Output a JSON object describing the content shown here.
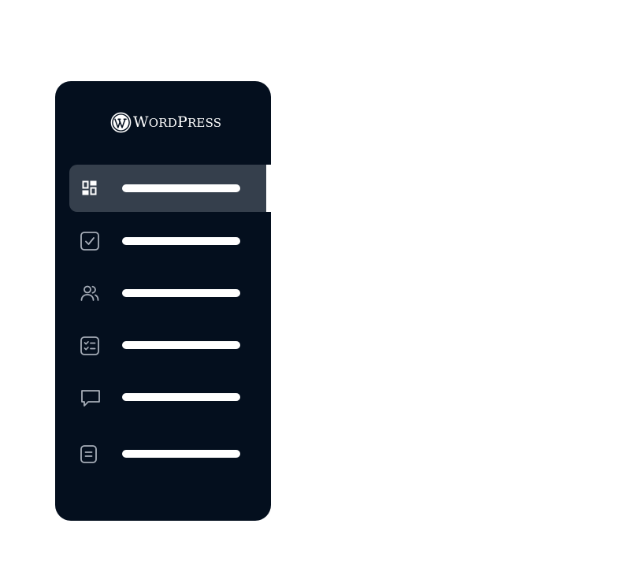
{
  "logo": {
    "text_first": "W",
    "text_rest": "ORD",
    "text_second": "P",
    "text_second_rest": "RESS",
    "icon": "wordpress-logo-icon"
  },
  "menu": {
    "items": [
      {
        "name": "dashboard",
        "icon": "dashboard-icon",
        "active": true
      },
      {
        "name": "tasks",
        "icon": "checkbox-icon",
        "active": false
      },
      {
        "name": "users",
        "icon": "users-icon",
        "active": false
      },
      {
        "name": "checklist",
        "icon": "checklist-icon",
        "active": false
      },
      {
        "name": "comments",
        "icon": "comment-icon",
        "active": false
      },
      {
        "name": "pages",
        "icon": "document-icon",
        "active": false
      }
    ]
  },
  "colors": {
    "sidebar_bg": "#040f1e",
    "active_bg": "#353f4c",
    "icon": "#a6adb8",
    "active_icon": "#ffffff",
    "bar": "#ffffff"
  }
}
